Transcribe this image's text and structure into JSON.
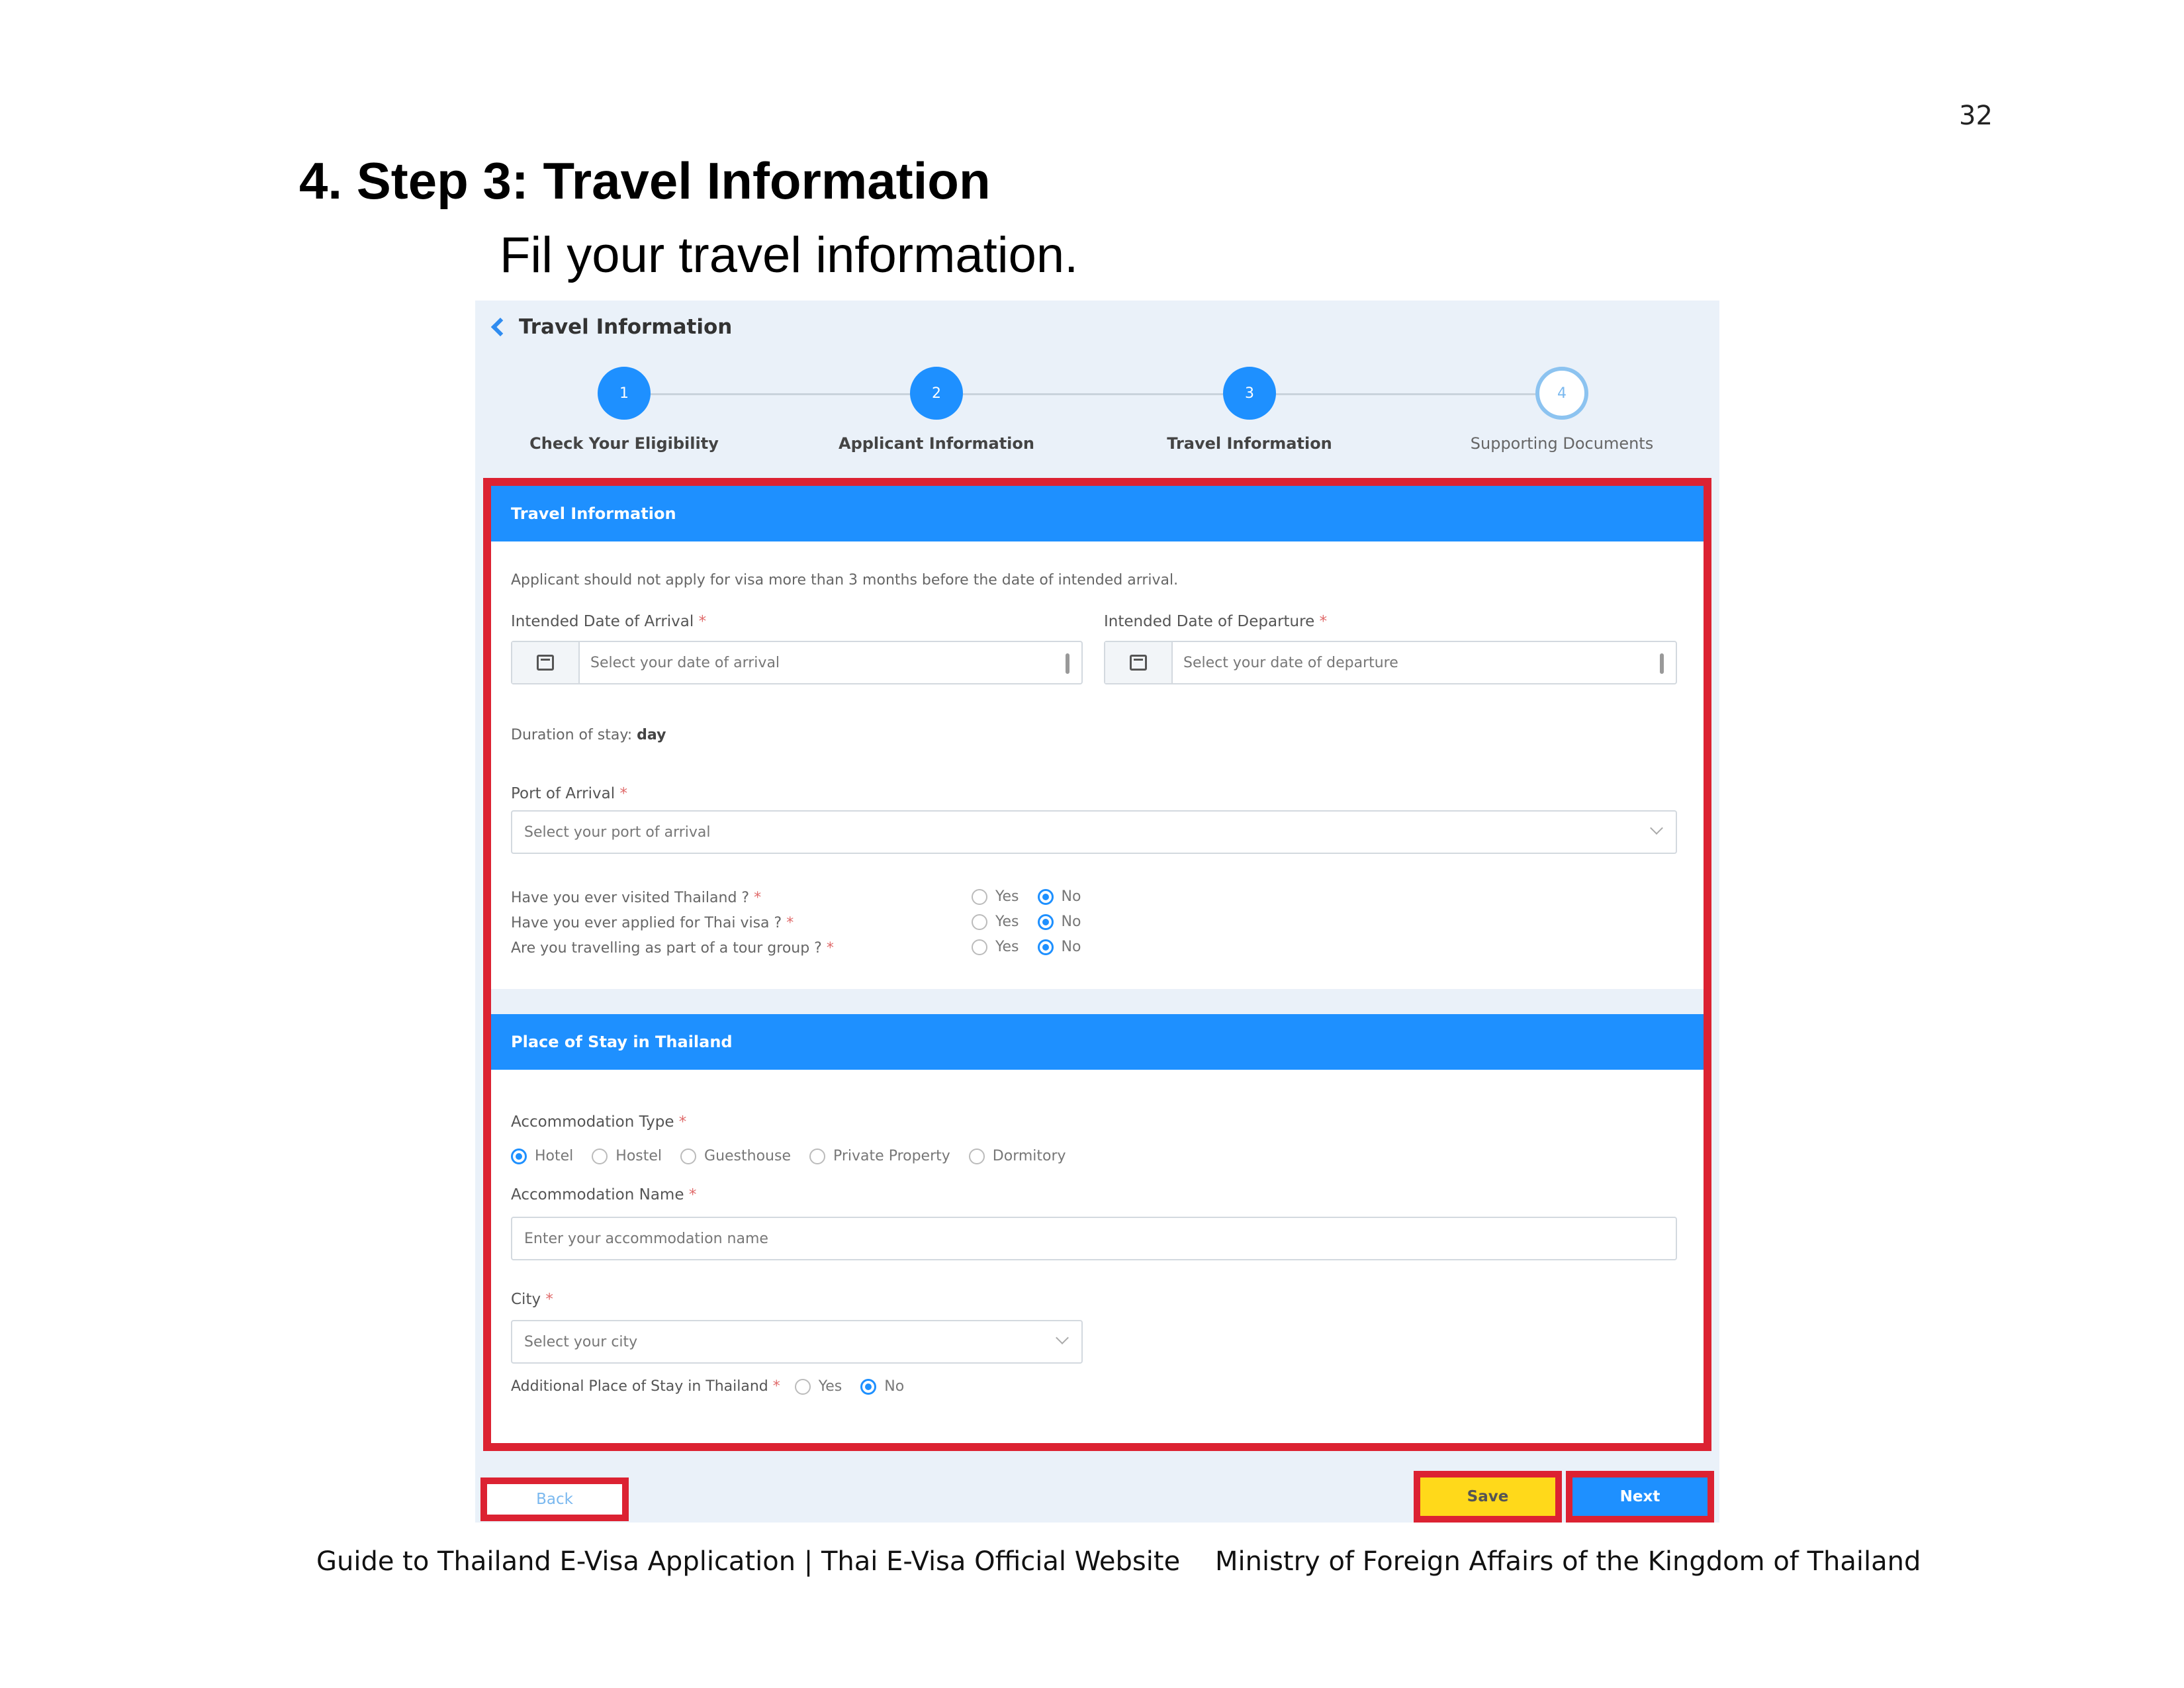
{
  "page": {
    "number": "32",
    "heading": "4. Step 3: Travel Information",
    "subheading": "Fil your travel information."
  },
  "app": {
    "title": "Travel Information",
    "steps": [
      {
        "number": "1",
        "label": "Check Your Eligibility",
        "state": "done"
      },
      {
        "number": "2",
        "label": "Applicant Information",
        "state": "done"
      },
      {
        "number": "3",
        "label": "Travel Information",
        "state": "active"
      },
      {
        "number": "4",
        "label": "Supporting Documents",
        "state": "pending"
      }
    ],
    "travel": {
      "section_title": "Travel Information",
      "notice": "Applicant should not apply for visa more than 3 months before the date of intended arrival.",
      "arrival_label": "Intended Date of Arrival",
      "arrival_placeholder": "Select your date of arrival",
      "departure_label": "Intended Date of Departure",
      "departure_placeholder": "Select your date of departure",
      "duration_label": "Duration of stay:",
      "duration_value": "day",
      "port_label": "Port of Arrival",
      "port_placeholder": "Select your port of arrival",
      "questions": [
        {
          "label": "Have you ever visited Thailand ?",
          "yes": "Yes",
          "no": "No",
          "selected": "No"
        },
        {
          "label": "Have you ever applied for Thai visa ?",
          "yes": "Yes",
          "no": "No",
          "selected": "No"
        },
        {
          "label": "Are you travelling as part of a tour group ?",
          "yes": "Yes",
          "no": "No",
          "selected": "No"
        }
      ]
    },
    "stay": {
      "section_title": "Place of Stay in Thailand",
      "accommodation_type_label": "Accommodation Type",
      "accommodation_types": [
        "Hotel",
        "Hostel",
        "Guesthouse",
        "Private Property",
        "Dormitory"
      ],
      "accommodation_type_selected": "Hotel",
      "accommodation_name_label": "Accommodation Name",
      "accommodation_name_placeholder": "Enter your accommodation name",
      "city_label": "City",
      "city_placeholder": "Select your city",
      "additional_label": "Additional Place of Stay in Thailand",
      "additional_yes": "Yes",
      "additional_no": "No",
      "additional_selected": "No"
    },
    "buttons": {
      "back": "Back",
      "save": "Save",
      "next": "Next"
    },
    "required_mark": "*"
  },
  "footer": {
    "left": "Guide to Thailand E-Visa Application | Thai E-Visa Official Website",
    "right": "Ministry of Foreign Affairs of the Kingdom of Thailand"
  },
  "colors": {
    "accent": "#1e90ff",
    "highlight": "#dc2232",
    "save": "#ffd91a"
  }
}
